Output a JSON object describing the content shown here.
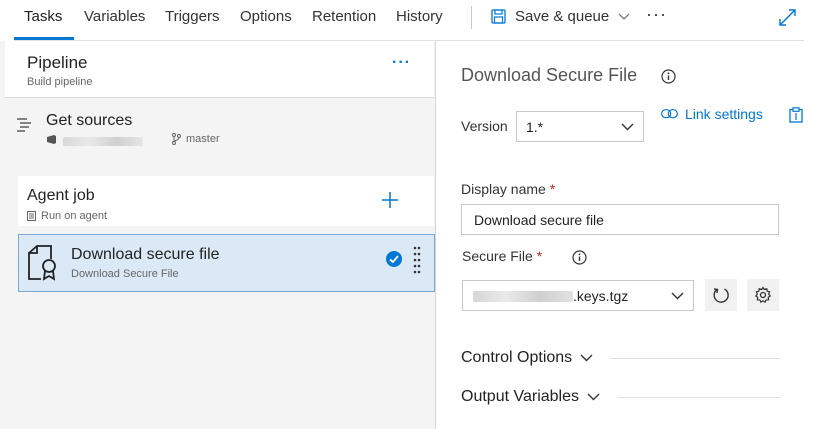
{
  "tabs": [
    {
      "label": "Tasks",
      "active": true
    },
    {
      "label": "Variables"
    },
    {
      "label": "Triggers"
    },
    {
      "label": "Options"
    },
    {
      "label": "Retention"
    },
    {
      "label": "History"
    }
  ],
  "toolbar": {
    "save_queue_label": "Save & queue",
    "more_label": "···",
    "save_icon": "save-icon",
    "expand_icon": "expand-icon"
  },
  "pipeline": {
    "title": "Pipeline",
    "subtitle": "Build pipeline",
    "more_label": "···"
  },
  "get_sources": {
    "title": "Get sources",
    "branch": "master"
  },
  "agent_job": {
    "title": "Agent job",
    "subtitle": "Run on agent"
  },
  "task": {
    "title": "Download secure file",
    "subtitle": "Download Secure File"
  },
  "details": {
    "title": "Download Secure File",
    "version_label": "Version",
    "version_value": "1.*",
    "link_settings_label": "Link settings",
    "display_name_label": "Display name",
    "display_name_value": "Download secure file",
    "secure_file_label": "Secure File",
    "secure_file_value": ".keys.tgz",
    "required_marker": "*",
    "control_options_label": "Control Options",
    "output_variables_label": "Output Variables"
  },
  "colors": {
    "accent": "#0078d4",
    "selected_bg": "#dbe9f7",
    "required": "#c0281c"
  }
}
